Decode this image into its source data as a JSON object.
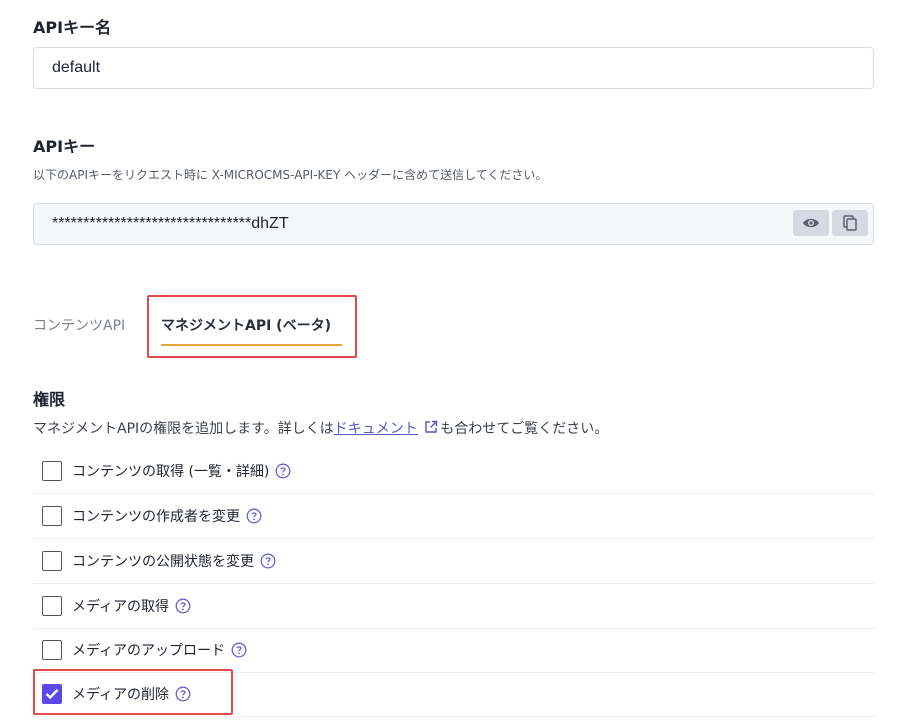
{
  "api_key_name": {
    "label": "APIキー名",
    "value": "default"
  },
  "api_key": {
    "label": "APIキー",
    "help": "以下のAPIキーをリクエスト時に X-MICROCMS-API-KEY ヘッダーに含めて送信してください。",
    "masked_value": "********************************dhZT"
  },
  "tabs": [
    {
      "label": "コンテンツAPI",
      "active": false
    },
    {
      "label": "マネジメントAPI (ベータ)",
      "active": true
    }
  ],
  "permissions": {
    "title": "権限",
    "desc_before": "マネジメントAPIの権限を追加します。詳しくは",
    "desc_link": "ドキュメント",
    "desc_after": "も合わせてご覧ください。",
    "items": [
      {
        "label": "コンテンツの取得 (一覧・詳細)",
        "checked": false
      },
      {
        "label": "コンテンツの作成者を変更",
        "checked": false
      },
      {
        "label": "コンテンツの公開状態を変更",
        "checked": false
      },
      {
        "label": "メディアの取得",
        "checked": false
      },
      {
        "label": "メディアのアップロード",
        "checked": false
      },
      {
        "label": "メディアの削除",
        "checked": true
      }
    ]
  },
  "colors": {
    "accent": "#5b48e8",
    "tab_underline": "#e8a43c",
    "highlight": "#e5484d"
  }
}
